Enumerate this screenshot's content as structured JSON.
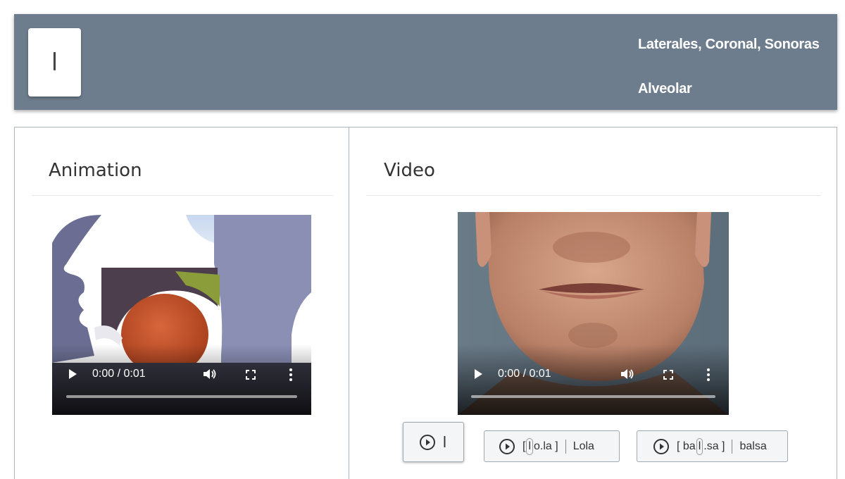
{
  "header": {
    "symbol": "l",
    "features": [
      "Laterales, Coronal, Sonoras",
      "Alveolar"
    ]
  },
  "animation": {
    "title": "Animation",
    "player": {
      "time": "0:00 / 0:01"
    }
  },
  "video": {
    "title": "Video",
    "player": {
      "time": "0:00 / 0:01"
    }
  },
  "sound_buttons": [
    {
      "label": "l"
    },
    {
      "pre": "[",
      "hl": "l",
      "post": "o.la ]",
      "word": "Lola"
    },
    {
      "pre": "[ ba",
      "hl": "l",
      "post": ".sa ]",
      "word": "balsa"
    }
  ],
  "colors": {
    "header_bg": "#6e7d8e",
    "border": "#a9b5c1"
  }
}
